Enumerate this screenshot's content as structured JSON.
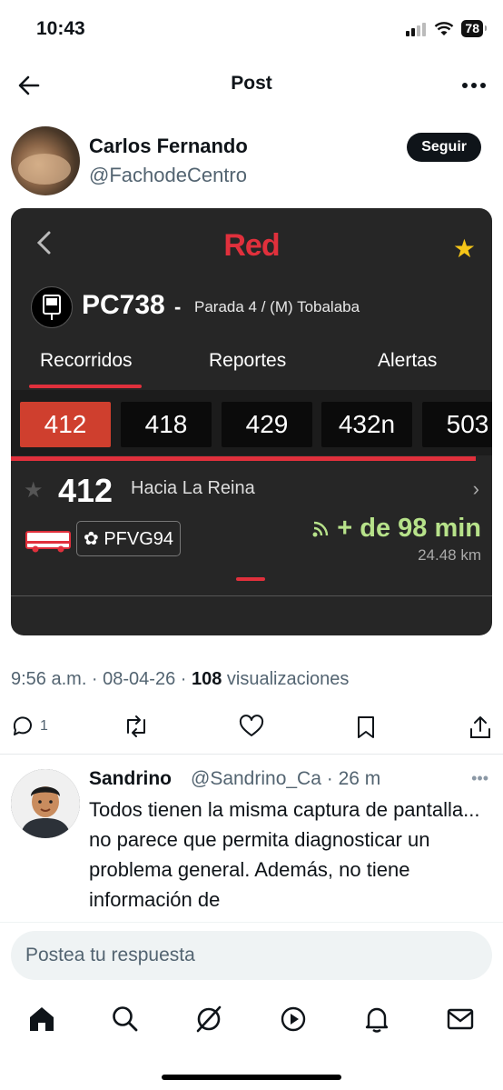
{
  "status": {
    "time": "10:43",
    "battery": "78"
  },
  "nav": {
    "title": "Post"
  },
  "author": {
    "name": "Carlos Fernando",
    "handle": "@FachodeCentro",
    "follow_label": "Seguir"
  },
  "shot": {
    "logo": "Red",
    "stop_code": "PC738",
    "stop_dash": "-",
    "stop_name": "Parada 4 / (M) Tobalaba",
    "tabs": [
      "Recorridos",
      "Reportes",
      "Alertas"
    ],
    "routes": [
      "412",
      "418",
      "429",
      "432n",
      "503"
    ],
    "selected_route": "412",
    "route_direction": "Hacia La Reina",
    "plate": "PFVG94",
    "eta": "+ de 98 min",
    "distance": "24.48 km",
    "colors": {
      "brand": "#e0303c",
      "eta": "#b7e28a",
      "star": "#f5c518"
    }
  },
  "meta": {
    "time_date": "9:56 a.m. · 08-04-26 · ",
    "views_count": "108",
    "views_label": " visualizaciones"
  },
  "actions": {
    "replies": "1"
  },
  "reply": {
    "name": "Sandrino",
    "handle_time": "@Sandrino_Ca · 26 m",
    "text": "Todos tienen la misma captura de pantalla... no parece que permita diagnosticar un problema general. Además, no tiene  información de"
  },
  "composer": {
    "placeholder": "Postea tu respuesta"
  }
}
